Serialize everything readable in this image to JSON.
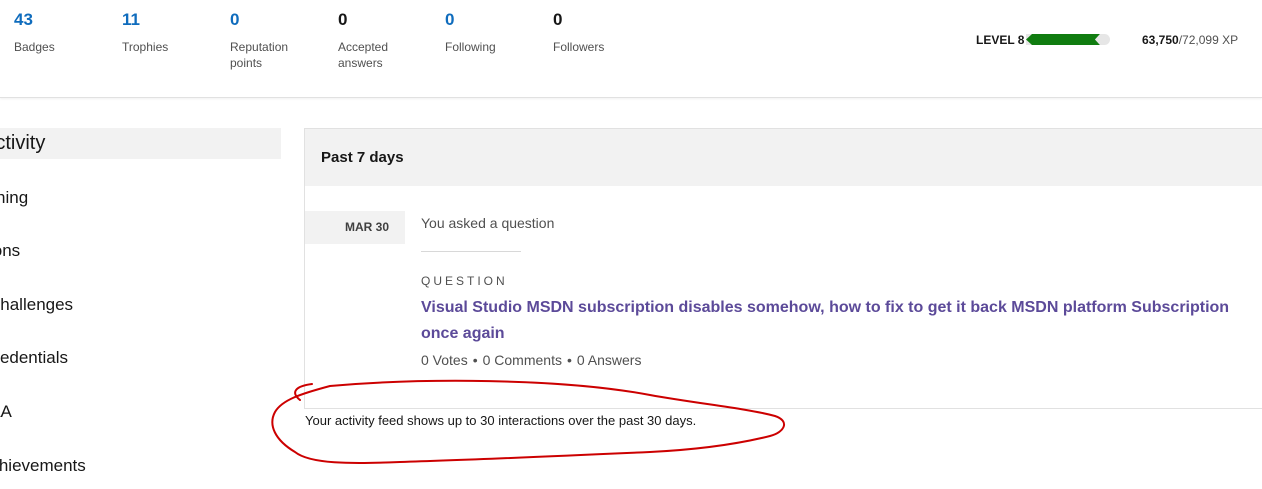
{
  "stats": [
    {
      "value": "43",
      "label": "Badges",
      "color": "blue"
    },
    {
      "value": "11",
      "label": "Trophies",
      "color": "blue"
    },
    {
      "value": "0",
      "label": "Reputation points",
      "color": "blue"
    },
    {
      "value": "0",
      "label": "Accepted answers",
      "color": "dark"
    },
    {
      "value": "0",
      "label": "Following",
      "color": "blue"
    },
    {
      "value": "0",
      "label": "Followers",
      "color": "dark"
    }
  ],
  "level": {
    "label": "LEVEL 8",
    "xp_current": "63,750",
    "xp_total": "/72,099 XP",
    "progress_fraction": 0.88,
    "fill_color": "#107c10"
  },
  "nav": {
    "items": [
      {
        "label": "Activity",
        "active": true
      },
      {
        "label": "Learning",
        "active": false
      },
      {
        "label": "Collections",
        "active": false
      },
      {
        "label": "Challenges",
        "active": false
      },
      {
        "label": "Credentials",
        "active": false
      },
      {
        "label": "Q&A",
        "active": false
      },
      {
        "label": "Achievements",
        "active": false
      }
    ]
  },
  "activity": {
    "period": "Past 7 days",
    "date": "MAR 30",
    "event": "You asked a question",
    "kicker": "QUESTION",
    "title": "Visual Studio MSDN subscription disables somehow, how to fix to get it back MSDN platform Subscription once again",
    "votes": "0 Votes",
    "comments": "0 Comments",
    "answers": "0 Answers",
    "separator": "•"
  },
  "footnote": "Your activity feed shows up to 30 interactions over the past 30 days.",
  "colors": {
    "link": "#5c4a99",
    "stat_blue": "#0f6cbd",
    "annotation": "#cc0000"
  }
}
